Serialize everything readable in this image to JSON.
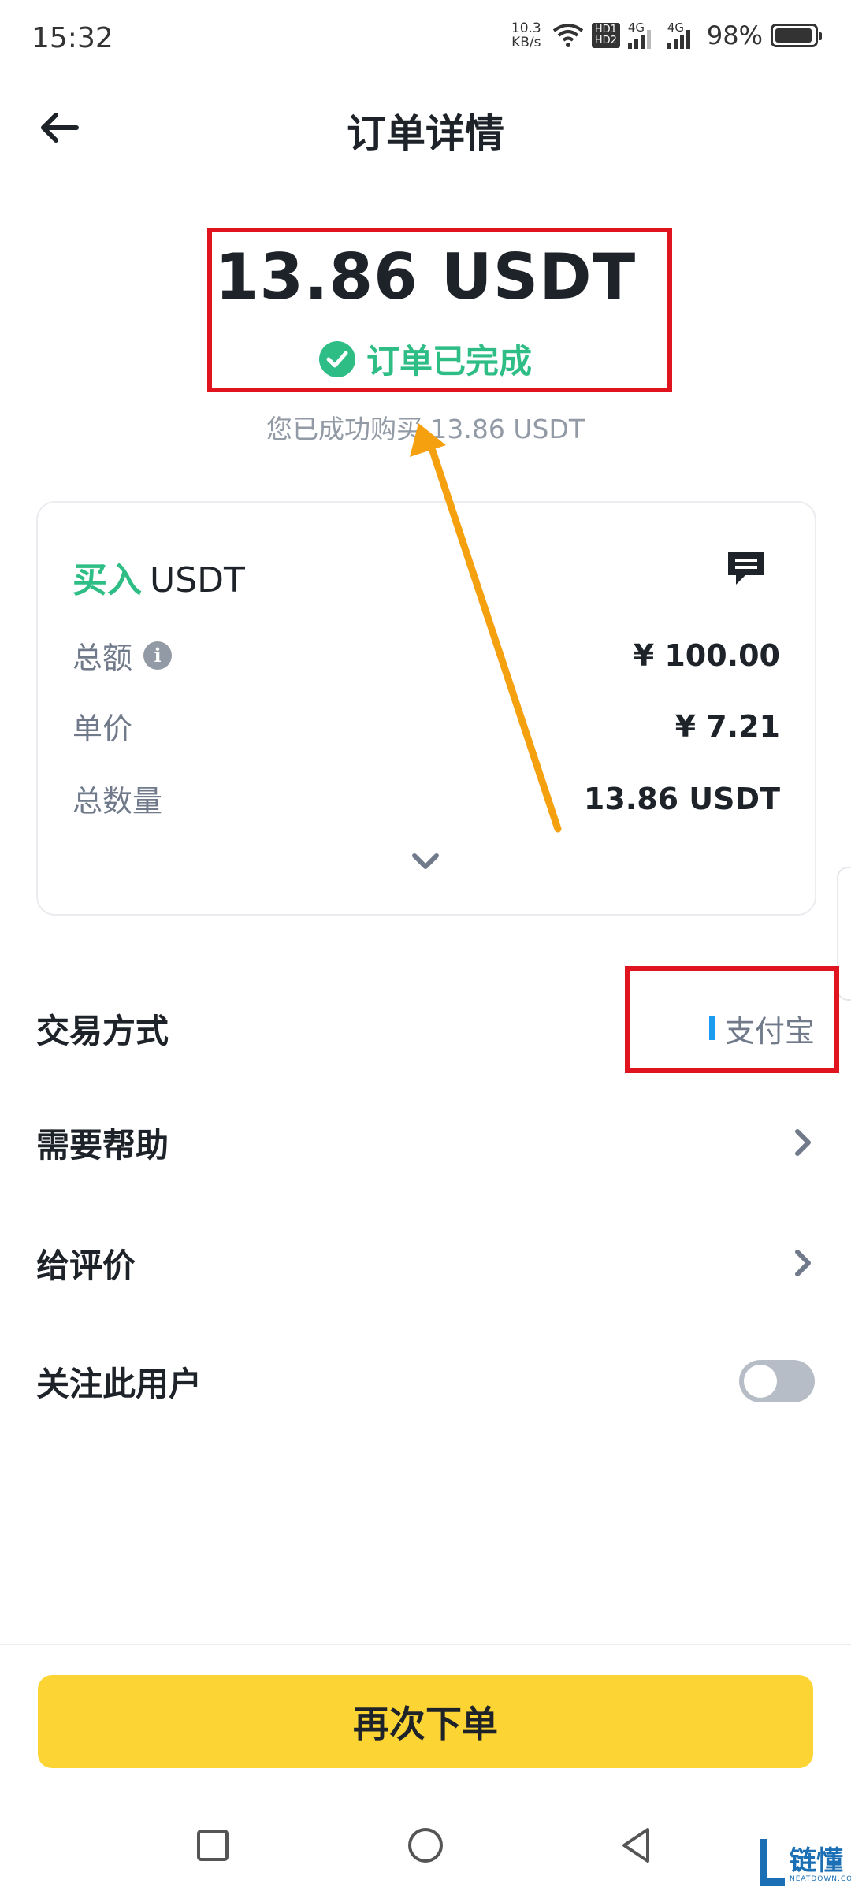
{
  "status_bar": {
    "time": "15:32",
    "net_speed": "10.3",
    "net_unit": "KB/s",
    "hd_badge_1": "HD1",
    "hd_badge_2": "HD2",
    "signal_1": "4G",
    "signal_2": "4G",
    "battery": "98%"
  },
  "header": {
    "title": "订单详情",
    "back_icon": "arrow-left-icon"
  },
  "summary": {
    "amount": "13.86 USDT",
    "status": "订单已完成",
    "status_icon": "check-circle-icon",
    "subtext": "您已成功购买  13.86 USDT"
  },
  "card": {
    "side": "买入",
    "asset": "USDT",
    "chat_icon": "chat-bubble-icon",
    "rows": [
      {
        "label": "总额",
        "value": "¥ 100.00",
        "has_info": true
      },
      {
        "label": "单价",
        "value": "¥ 7.21",
        "has_info": false
      },
      {
        "label": "总数量",
        "value": "13.86 USDT",
        "has_info": false
      }
    ],
    "expand_icon": "chevron-down-icon"
  },
  "menu": {
    "payment": {
      "label": "交易方式",
      "value": "支付宝"
    },
    "help": {
      "label": "需要帮助"
    },
    "review": {
      "label": "给评价"
    },
    "follow": {
      "label": "关注此用户",
      "toggle_on": false
    }
  },
  "cta": {
    "label": "再次下单"
  },
  "watermark": {
    "text": "链懂",
    "sub": "NEATDOWN.COM"
  },
  "colors": {
    "accent_green": "#2ebd85",
    "brand_yellow": "#fcd535",
    "highlight_red": "#e0141e",
    "arrow_orange": "#f5a00f",
    "alipay_blue": "#1a9bf0"
  }
}
